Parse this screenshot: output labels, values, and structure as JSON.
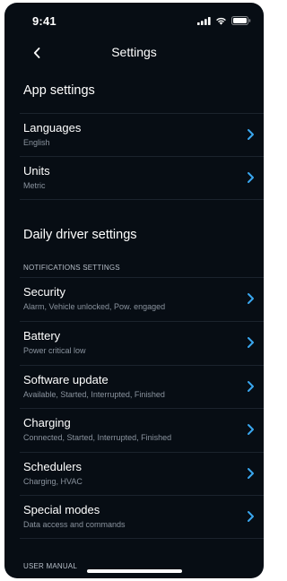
{
  "status_bar": {
    "time": "9:41"
  },
  "header": {
    "title": "Settings"
  },
  "sections": {
    "app_settings": {
      "title": "App settings",
      "items": [
        {
          "label": "Languages",
          "value": "English"
        },
        {
          "label": "Units",
          "value": "Metric"
        }
      ]
    },
    "daily_driver": {
      "title": "Daily driver settings",
      "subheader": "NOTIFICATIONS SETTINGS",
      "items": [
        {
          "label": "Security",
          "value": "Alarm, Vehicle unlocked, Pow. engaged"
        },
        {
          "label": "Battery",
          "value": "Power critical low"
        },
        {
          "label": "Software update",
          "value": "Available, Started, Interrupted, Finished"
        },
        {
          "label": "Charging",
          "value": "Connected, Started, Interrupted, Finished"
        },
        {
          "label": "Schedulers",
          "value": "Charging, HVAC"
        },
        {
          "label": "Special modes",
          "value": "Data access and commands"
        }
      ]
    },
    "user_manual": {
      "title": "USER MANUAL"
    }
  },
  "colors": {
    "background": "#070d14",
    "accent": "#3aa8f0",
    "divider": "#1b232d",
    "secondary_text": "#8a939e"
  }
}
